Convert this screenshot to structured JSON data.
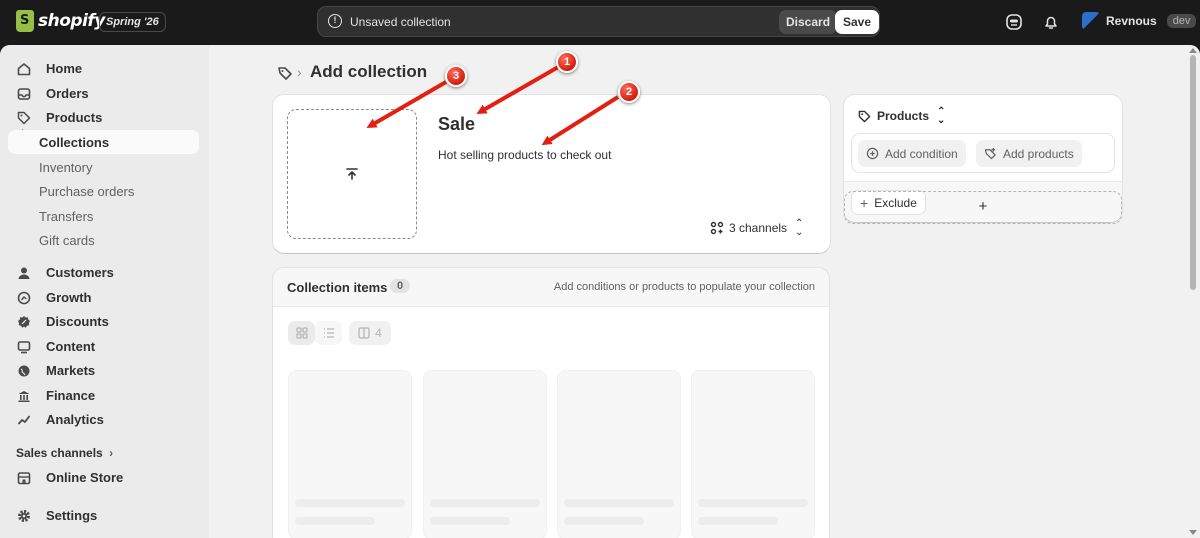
{
  "topbar": {
    "logo": "shopify",
    "edition": "Spring '26",
    "unsaved_text": "Unsaved collection",
    "discard_label": "Discard",
    "save_label": "Save",
    "user_name": "Revnous",
    "user_badge": "dev"
  },
  "sidebar": {
    "items": [
      {
        "label": "Home",
        "icon": "home-icon"
      },
      {
        "label": "Orders",
        "icon": "inbox-icon"
      },
      {
        "label": "Products",
        "icon": "tag-icon"
      }
    ],
    "product_subitems": [
      "Collections",
      "Inventory",
      "Purchase orders",
      "Transfers",
      "Gift cards"
    ],
    "items2": [
      {
        "label": "Customers",
        "icon": "person-icon"
      },
      {
        "label": "Growth",
        "icon": "growth-icon"
      },
      {
        "label": "Discounts",
        "icon": "discount-icon"
      },
      {
        "label": "Content",
        "icon": "content-icon"
      },
      {
        "label": "Markets",
        "icon": "globe-icon"
      },
      {
        "label": "Finance",
        "icon": "bank-icon"
      },
      {
        "label": "Analytics",
        "icon": "analytics-icon"
      }
    ],
    "sales_channels_label": "Sales channels",
    "online_store_label": "Online Store",
    "settings_label": "Settings"
  },
  "page": {
    "title": "Add collection"
  },
  "collection": {
    "title": "Sale",
    "description": "Hot selling products to check out",
    "channels": "3 channels"
  },
  "items": {
    "title": "Collection items",
    "count": "0",
    "hint": "Add conditions or products to populate your collection",
    "columns": "4"
  },
  "products_card": {
    "header": "Products",
    "add_condition": "Add condition",
    "add_products": "Add products",
    "exclude": "Exclude",
    "add_plus": "+"
  },
  "callouts": [
    "1",
    "2",
    "3"
  ],
  "colors": {
    "topbar": "#1a1a1a",
    "callout": "#d41f10",
    "page_bg": "#f1f1f1"
  }
}
